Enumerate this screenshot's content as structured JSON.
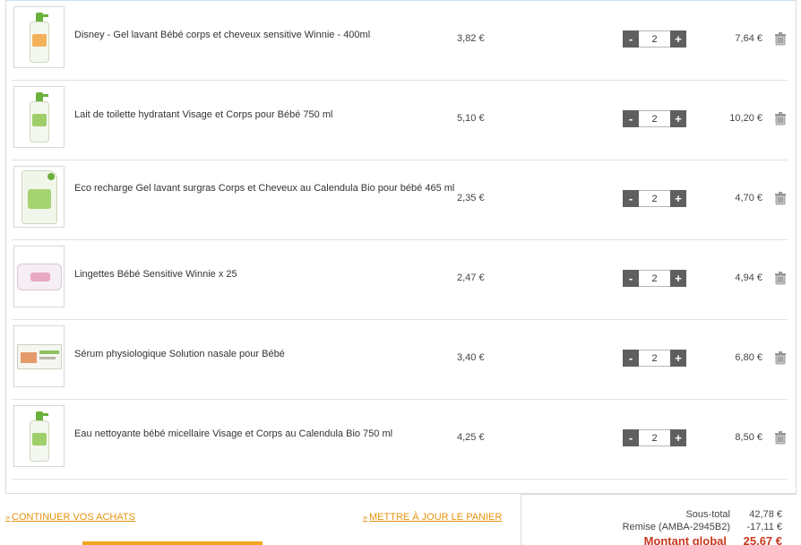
{
  "items": [
    {
      "name": "Disney - Gel lavant Bébé corps et cheveux sensitive Winnie - 400ml",
      "unit_price": "3,82 €",
      "qty": "2",
      "total": "7,64 €",
      "image": "bottle-orange"
    },
    {
      "name": "Lait de toilette hydratant Visage et Corps pour Bébé 750 ml",
      "unit_price": "5,10 €",
      "qty": "2",
      "total": "10,20 €",
      "image": "bottle-green"
    },
    {
      "name": "Eco recharge Gel lavant surgras Corps et Cheveux au Calendula Bio pour bébé 465 ml",
      "unit_price": "2,35 €",
      "qty": "2",
      "total": "4,70 €",
      "image": "pouch"
    },
    {
      "name": "Lingettes Bébé Sensitive Winnie x 25",
      "unit_price": "2,47 €",
      "qty": "2",
      "total": "4,94 €",
      "image": "wipes"
    },
    {
      "name": "Sérum physiologique Solution nasale pour Bébé",
      "unit_price": "3,40 €",
      "qty": "2",
      "total": "6,80 €",
      "image": "box"
    },
    {
      "name": "Eau nettoyante bébé micellaire Visage et Corps au Calendula Bio 750 ml",
      "unit_price": "4,25 €",
      "qty": "2",
      "total": "8,50 €",
      "image": "bottle-green"
    }
  ],
  "controls": {
    "minus": "-",
    "plus": "+"
  },
  "footer": {
    "chevron": "»",
    "continue_label": "CONTINUER VOS ACHATS",
    "update_label": "METTRE À JOUR LE PANIER"
  },
  "totals": {
    "subtotal_label": "Sous-total",
    "subtotal_value": "42,78 €",
    "discount_label": "Remise (AMBA-2945B2)",
    "discount_value": "-17,11 €",
    "grand_label": "Montant global",
    "grand_value": "25,67 €"
  },
  "colors": {
    "link": "#e8930c",
    "grand_total": "#c9381e",
    "qty_button": "#5f5f5f"
  }
}
